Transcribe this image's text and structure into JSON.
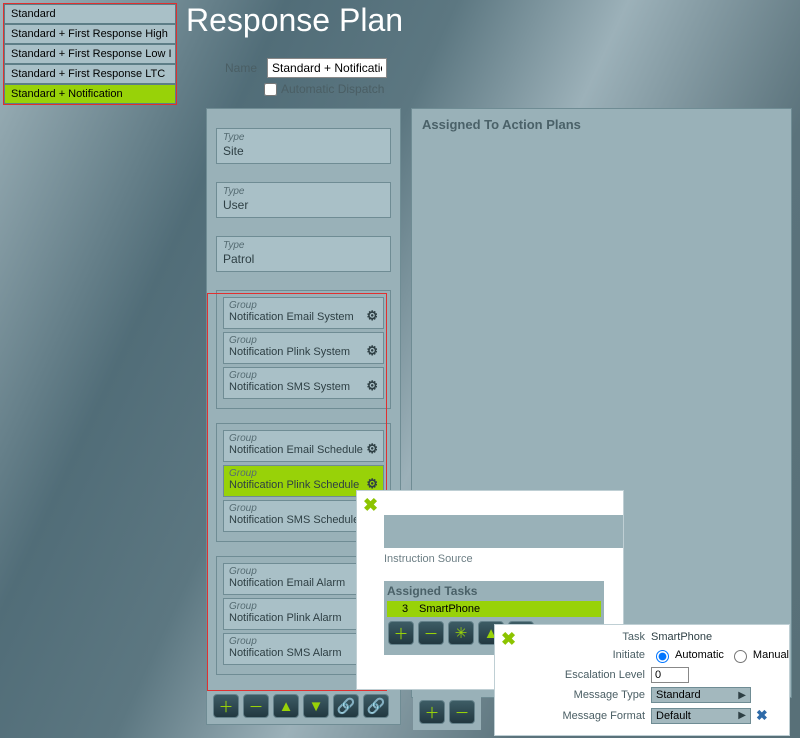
{
  "page_title": "Response Plan",
  "sidebar": {
    "items": [
      {
        "label": "Standard"
      },
      {
        "label": "Standard + First Response High"
      },
      {
        "label": "Standard + First Response Low I"
      },
      {
        "label": "Standard + First Response LTC"
      },
      {
        "label": "Standard + Notification"
      }
    ],
    "selected_index": 4
  },
  "form": {
    "name_label": "Name",
    "name_value": "Standard + Notification",
    "auto_dispatch_label": "Automatic Dispatch",
    "auto_dispatch_checked": false
  },
  "types": [
    {
      "kind_label": "Type",
      "value": "Site"
    },
    {
      "kind_label": "Type",
      "value": "User"
    },
    {
      "kind_label": "Type",
      "value": "Patrol"
    }
  ],
  "group_blocks": [
    {
      "rows": [
        {
          "kind_label": "Group",
          "value": "Notification Email System",
          "gear": true
        },
        {
          "kind_label": "Group",
          "value": "Notification Plink System",
          "gear": true
        },
        {
          "kind_label": "Group",
          "value": "Notification SMS System",
          "gear": true
        }
      ]
    },
    {
      "rows": [
        {
          "kind_label": "Group",
          "value": "Notification Email Schedule",
          "gear": true
        },
        {
          "kind_label": "Group",
          "value": "Notification Plink Schedule",
          "gear": true,
          "selected": true
        },
        {
          "kind_label": "Group",
          "value": "Notification SMS Schedule",
          "gear": true
        }
      ]
    },
    {
      "rows": [
        {
          "kind_label": "Group",
          "value": "Notification Email Alarm"
        },
        {
          "kind_label": "Group",
          "value": "Notification Plink Alarm"
        },
        {
          "kind_label": "Group",
          "value": "Notification SMS Alarm"
        }
      ]
    }
  ],
  "right_panel": {
    "title": "Assigned To Action Plans"
  },
  "dlg1": {
    "instruction_source_label": "Instruction Source",
    "assigned_tasks_label": "Assigned Tasks",
    "task_number": "3",
    "task_name": "SmartPhone"
  },
  "dlg2": {
    "task_label": "Task",
    "task_value": "SmartPhone",
    "initiate_label": "Initiate",
    "initiate_automatic": "Automatic",
    "initiate_manual": "Manual",
    "initiate_value": "automatic",
    "escalation_label": "Escalation Level",
    "escalation_value": "0",
    "message_type_label": "Message Type",
    "message_type_value": "Standard",
    "message_format_label": "Message Format",
    "message_format_value": "Default"
  },
  "icons": {
    "gear": "⚙",
    "close": "✖",
    "plus": "＋",
    "minus": "－",
    "up": "▲",
    "down": "▼",
    "link": "🔗",
    "burst": "✳",
    "arrow_right": "▶"
  }
}
